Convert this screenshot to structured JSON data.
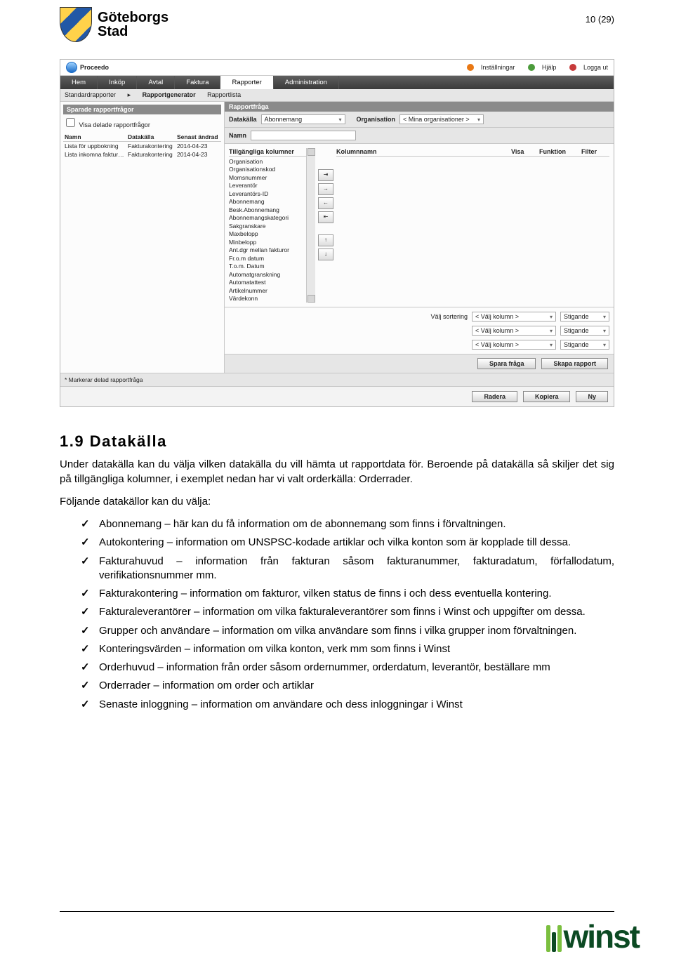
{
  "page_number": "10 (29)",
  "org": {
    "line1": "Göteborgs",
    "line2": "Stad"
  },
  "app": {
    "name": "Proceedo",
    "toplinks": {
      "settings": "Inställningar",
      "help": "Hjälp",
      "logout": "Logga ut"
    },
    "menu": [
      "Hem",
      "Inköp",
      "Avtal",
      "Faktura",
      "Rapporter",
      "Administration"
    ],
    "menu_active": "Rapporter",
    "submenu": {
      "s1": "Standardrapporter",
      "s2": "Rapportgenerator",
      "s3": "Rapportlista"
    },
    "saved": {
      "title": "Sparade rapportfrågor",
      "checkbox": "Visa delade rapportfrågor",
      "cols": {
        "c1": "Namn",
        "c2": "Datakälla",
        "c3": "Senast ändrad"
      },
      "rows": [
        {
          "c1": "Lista för uppbokning",
          "c2": "Fakturakontering",
          "c3": "2014-04-23"
        },
        {
          "c1": "Lista inkomna faktur…",
          "c2": "Fakturakontering",
          "c3": "2014-04-23"
        }
      ]
    },
    "query": {
      "title": "Rapportfråga",
      "datakalla_lbl": "Datakälla",
      "datakalla_val": "Abonnemang",
      "org_lbl": "Organisation",
      "org_val": "< Mina organisationer >",
      "namn_lbl": "Namn",
      "avail_lbl": "Tillgängliga kolumner",
      "avail": [
        "Organisation",
        "Organisationskod",
        "Momsnummer",
        "Leverantör",
        "Leverantörs-ID",
        "Abonnemang",
        "Besk.Abonnemang",
        "Abonnemangskategori",
        "Sakgranskare",
        "Maxbelopp",
        "Minbelopp",
        "Ant.dgr mellan fakturor",
        "Fr.o.m datum",
        "T.o.m. Datum",
        "Automatgranskning",
        "Automatattest",
        "Artikelnummer",
        "Värdekonn"
      ],
      "kcols": {
        "c1": "Kolumnnamn",
        "c2": "Visa",
        "c3": "Funktion",
        "c4": "Filter"
      },
      "sort_lbl": "Välj sortering",
      "sort_col": "< Välj kolumn >",
      "sort_dir": "Stigande"
    },
    "btns": {
      "save": "Spara fråga",
      "create": "Skapa rapport",
      "del": "Radera",
      "copy": "Kopiera",
      "new": "Ny"
    },
    "footnote": "* Markerar delad rapportfråga"
  },
  "section": {
    "heading": "1.9 Datakälla",
    "p1": "Under datakälla kan du välja vilken datakälla du vill hämta ut rapportdata för. Beroende på datakälla så skiljer det sig på tillgängliga kolumner, i exemplet nedan har vi valt orderkälla: Orderrader.",
    "p2": "Följande datakällor kan du välja:",
    "items": [
      "Abonnemang – här kan du få information om de abonnemang som finns i förvaltningen.",
      "Autokontering – information om UNSPSC-kodade artiklar och vilka konton som är kopplade till dessa.",
      "Fakturahuvud – information från fakturan såsom fakturanummer, fakturadatum, förfallodatum, verifikationsnummer mm.",
      "Fakturakontering – information om fakturor, vilken status de finns i och dess eventuella kontering.",
      "Fakturaleverantörer – information om vilka fakturaleverantörer som finns i Winst och uppgifter om dessa.",
      "Grupper och användare – information om vilka användare som finns i vilka grupper inom förvaltningen.",
      "Konteringsvärden – information om vilka konton, verk mm som finns i Winst",
      "Orderhuvud – information från order såsom ordernummer, orderdatum, leverantör, beställare mm",
      "Orderrader – information om order och artiklar",
      "Senaste inloggning – information om användare och dess inloggningar i Winst"
    ]
  },
  "footer_brand": "winst"
}
